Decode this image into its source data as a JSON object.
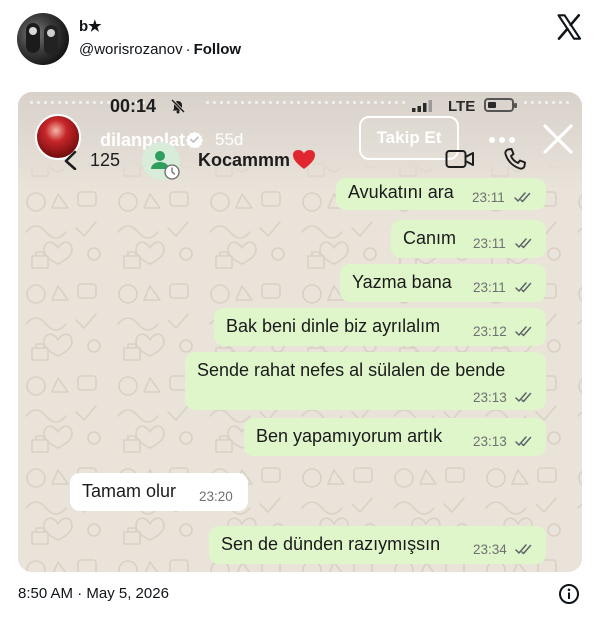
{
  "tweet": {
    "display_name": "b★",
    "handle": "@worisrozanov",
    "separator": "·",
    "follow_label": "Follow",
    "timestamp": "8:50 AM · May 5, 2026"
  },
  "screenshot": {
    "status_bar": {
      "time": "00:14",
      "network": "LTE"
    },
    "story": {
      "username": "dilanpolat",
      "age": "55d",
      "follow_button": "Takip Et"
    },
    "chat_header": {
      "unread_count": "125",
      "contact_name": "Kocammm"
    },
    "messages": [
      {
        "direction": "out",
        "text": "Avukatını ara",
        "time": "23:11"
      },
      {
        "direction": "out",
        "text": "Canım",
        "time": "23:11"
      },
      {
        "direction": "out",
        "text": "Yazma bana",
        "time": "23:11"
      },
      {
        "direction": "out",
        "text": "Bak beni dinle biz ayrılalım",
        "time": "23:12"
      },
      {
        "direction": "out",
        "text": "Sende rahat nefes al sülalen de bende",
        "time": "23:13"
      },
      {
        "direction": "out",
        "text": "Ben yapamıyorum artık",
        "time": "23:13"
      },
      {
        "direction": "in",
        "text": "Tamam olur",
        "time": "23:20"
      },
      {
        "direction": "out",
        "text": "Sen de dünden razıymışsın",
        "time": "23:34"
      }
    ]
  },
  "colors": {
    "outgoing_bubble": "#dff6cb",
    "incoming_bubble": "#ffffff",
    "chat_background": "#e9e3d9",
    "read_ticks": "#5f6368"
  },
  "icons": [
    "x-logo-icon",
    "bell-off-icon",
    "verified-badge-icon",
    "more-icon",
    "close-icon",
    "back-icon",
    "contact-avatar-icon",
    "heart-icon",
    "video-call-icon",
    "phone-icon",
    "double-tick-icon",
    "info-icon"
  ]
}
